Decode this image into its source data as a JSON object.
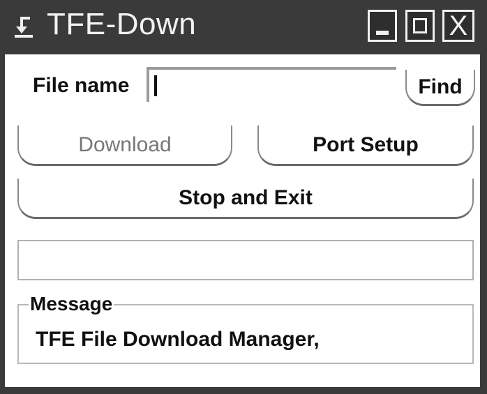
{
  "window": {
    "title": "TFE-Down",
    "controls": {
      "minimize": "minimize",
      "maximize": "maximize",
      "close_glyph": "X"
    },
    "icon": "download-arrow-icon"
  },
  "form": {
    "filename_label": "File name",
    "filename_value": "",
    "find_label": "Find"
  },
  "actions": {
    "download_label": "Download",
    "download_enabled": false,
    "port_setup_label": "Port Setup",
    "stop_exit_label": "Stop and Exit"
  },
  "status": {
    "text": ""
  },
  "message": {
    "legend": "Message",
    "text": "TFE File Download Manager,"
  },
  "colors": {
    "titlebar": "#3a3a3a",
    "disabled_text": "#777777"
  }
}
